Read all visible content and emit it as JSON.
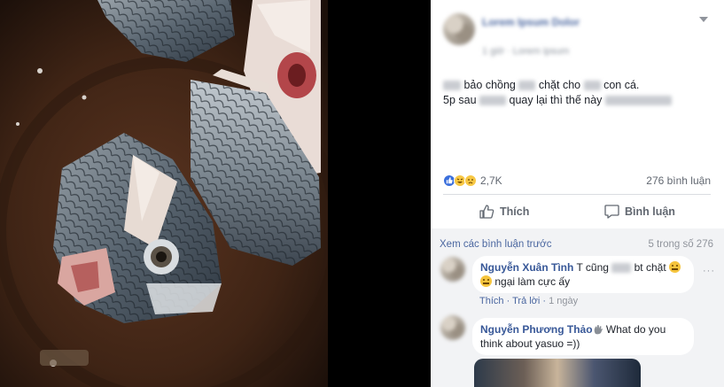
{
  "post": {
    "author_name": "Lorem Ipsum Dolor",
    "meta": "1 giờ · Lorem ipsum",
    "line1": {
      "a": "bảo chồng",
      "b": "chặt cho",
      "c": "con cá."
    },
    "line2": {
      "a": "5p sau",
      "b": "quay lại thì thế này"
    },
    "reaction_count": "2,7K",
    "comment_count": "276 bình luận",
    "like_label": "Thích",
    "comment_label": "Bình luận"
  },
  "comments": {
    "view_previous": "Xem các bình luận trước",
    "count_of": "5 trong số 276",
    "items": [
      {
        "name": "Nguyễn Xuân Tình",
        "text_a": "T cũng",
        "text_b": "bt chặt",
        "text_c": "ngại làm cực ấy",
        "like": "Thích",
        "reply": "Trả lời",
        "time": "1 ngày"
      },
      {
        "name": "Nguyễn Phương Thảo",
        "text_a": "What do you",
        "text_b": "think about yasuo =))"
      }
    ]
  },
  "icons": [
    "like-icon",
    "comment-icon",
    "chevron-down-icon",
    "more-icon",
    "wave-hand-icon",
    "smile-emoji-icon"
  ],
  "colors": {
    "link": "#4b67a0",
    "name": "#385898",
    "muted": "#90949c",
    "text": "#1d2129",
    "panel_bg": "#ffffff",
    "comments_bg": "#f2f3f5",
    "page_bg": "#000000"
  }
}
